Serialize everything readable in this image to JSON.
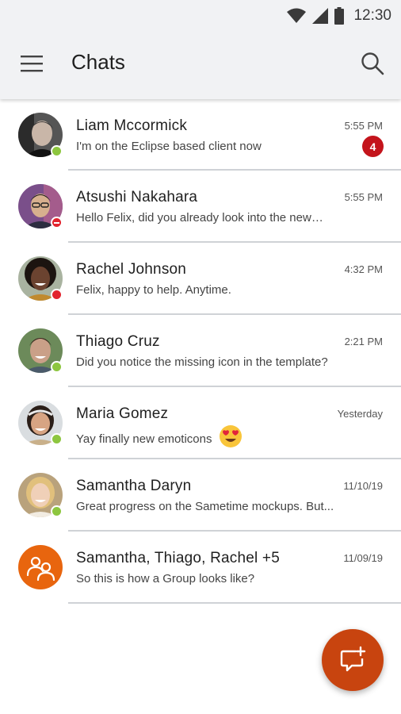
{
  "status_bar": {
    "time": "12:30",
    "icons": [
      "wifi-icon",
      "signal-icon",
      "battery-icon"
    ]
  },
  "app_bar": {
    "title": "Chats",
    "menu_icon": "menu-icon",
    "search_icon": "search-icon"
  },
  "colors": {
    "available": "#8dc63f",
    "busy": "#e2242e",
    "dnd": "#e2242e",
    "badge": "#c4141c",
    "fab": "#c8440f",
    "group_avatar": "#e8650e"
  },
  "chats": [
    {
      "name": "Liam Mccormick",
      "time": "5:55 PM",
      "preview": "I'm on the Eclipse based client now",
      "unread": "4",
      "presence": "available",
      "avatar": "person-photo"
    },
    {
      "name": "Atsushi Nakahara",
      "time": "5:55 PM",
      "preview": "Hello Felix, did you already look into the new…",
      "presence": "do-not-disturb",
      "avatar": "person-photo"
    },
    {
      "name": "Rachel Johnson",
      "time": "4:32 PM",
      "preview": "Felix, happy to help. Anytime.",
      "presence": "busy",
      "avatar": "person-photo"
    },
    {
      "name": "Thiago Cruz",
      "time": "2:21 PM",
      "preview": "Did you notice the missing icon in the template?",
      "presence": "available",
      "avatar": "person-photo"
    },
    {
      "name": "Maria Gomez",
      "time": "Yesterday",
      "preview": "Yay finally new emoticons",
      "emoticon": "heart-eyes-emoji",
      "presence": "available",
      "avatar": "person-photo"
    },
    {
      "name": "Samantha Daryn",
      "time": "11/10/19",
      "preview": "Great progress on the Sametime mockups. But...",
      "presence": "available",
      "avatar": "person-photo"
    },
    {
      "name": "Samantha, Thiago, Rachel +5",
      "time": "11/09/19",
      "preview": "So this is how a Group looks like?",
      "avatar": "group-icon"
    }
  ],
  "fab": {
    "icon": "new-chat-icon"
  }
}
